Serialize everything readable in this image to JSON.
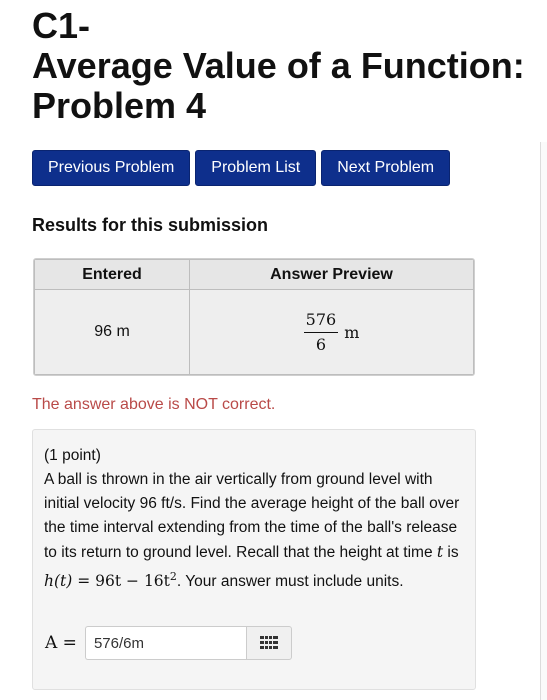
{
  "title": {
    "line1": "C1-",
    "line2": "Average Value of a Function:",
    "line3": "Problem 4"
  },
  "nav": {
    "previous_label": "Previous Problem",
    "list_label": "Problem List",
    "next_label": "Next Problem"
  },
  "results": {
    "heading": "Results for this submission",
    "columns": [
      "Entered",
      "Answer Preview"
    ],
    "entered": "96 m",
    "preview": {
      "numerator": "576",
      "denominator": "6",
      "unit": "m"
    },
    "status_message": "The answer above is NOT correct."
  },
  "problem": {
    "points": "(1 point)",
    "text_1": "A ball is thrown in the air vertically from ground level with initial velocity 96 ft/s. Find the average height of the ball over the time interval extending from the time of the ball's release to its return to ground level. Recall that the height at time ",
    "var_t": "t",
    "text_2": " is ",
    "formula_h": "h(t)",
    "formula_rest": " = 96t − 16t",
    "formula_exp": "2",
    "text_3": ". Your answer must include units.",
    "answer_label": "A =",
    "answer_value": "576/6m"
  },
  "icons": {
    "keyboard": "keypad-grid-icon"
  },
  "colors": {
    "nav_button": "#0e2f8c",
    "error_text": "#b94a48",
    "problem_bg": "#f5f5f5"
  }
}
